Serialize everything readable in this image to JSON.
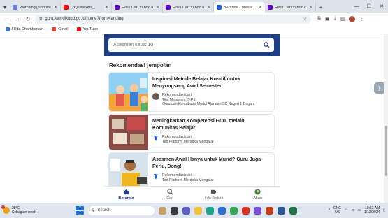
{
  "browser": {
    "tabs": [
      {
        "title": "Watching [Nodrive",
        "color": "#6b7fd7",
        "active": false
      },
      {
        "title": "(26) Diskorta_",
        "color": "#ff0000",
        "active": false
      },
      {
        "title": "Hasil Cari Yahoo u",
        "color": "#6001d2",
        "active": false
      },
      {
        "title": "Hasil Cari Yahoo u",
        "color": "#6001d2",
        "active": false
      },
      {
        "title": "Beranda - Merdeka",
        "color": "#1e5bd8",
        "active": true
      },
      {
        "title": "Hasil Cari Yahoo u",
        "color": "#6001d2",
        "active": false
      }
    ],
    "new_tab": "+",
    "url": "guru.kemdikbud.go.id/home?from=landing",
    "bookmarks": [
      {
        "label": "Hilda Chamberlain",
        "color": "#3b6fd1"
      },
      {
        "label": "Gmail",
        "color": "#ea4335"
      },
      {
        "label": "YouTube",
        "color": "#ff0000"
      }
    ]
  },
  "page": {
    "search": {
      "placeholder": "Asesmen kelas 10"
    },
    "section_title": "Rekomendasi jempolan",
    "cards": [
      {
        "title": "Inspirasi Metode Belajar Kreatif untuk Menyongsong Awal Semester",
        "rec_label": "Rekomendasi dari:",
        "rec_name": "Titis Megayani, S.Pd.",
        "rec_role": "Guru dan Kontributor Modul Ajar dari SD Negeri 1 Dagan"
      },
      {
        "title": "Meningkatkan Kompetensi Guru melalui Komunitas Belajar",
        "rec_label": "Rekomendasi dari:",
        "rec_name": "Tim Platform Merdeka Mengajar",
        "rec_role": ""
      },
      {
        "title": "Asesmen Awal Hanya untuk Murid? Guru Juga Perlu, Dong!",
        "rec_label": "Rekomendasi dari:",
        "rec_name": "Tim Platform Merdeka Mengajar",
        "rec_role": ""
      }
    ],
    "bottom_nav": [
      {
        "label": "Beranda",
        "icon": "home-icon",
        "active": true
      },
      {
        "label": "Cari",
        "icon": "search-icon",
        "active": false
      },
      {
        "label": "Info Terkini",
        "icon": "news-icon",
        "active": false
      },
      {
        "label": "Akun",
        "icon": "account-icon",
        "active": false
      }
    ],
    "accent_color": "#1e3f86"
  },
  "taskbar": {
    "weather_temp": "28°C",
    "weather_desc": "Sebagian cerah",
    "search_placeholder": "Search",
    "lang_1": "ENG",
    "lang_2": "US",
    "time": "10:53 AM",
    "date": "1/13/2024"
  }
}
